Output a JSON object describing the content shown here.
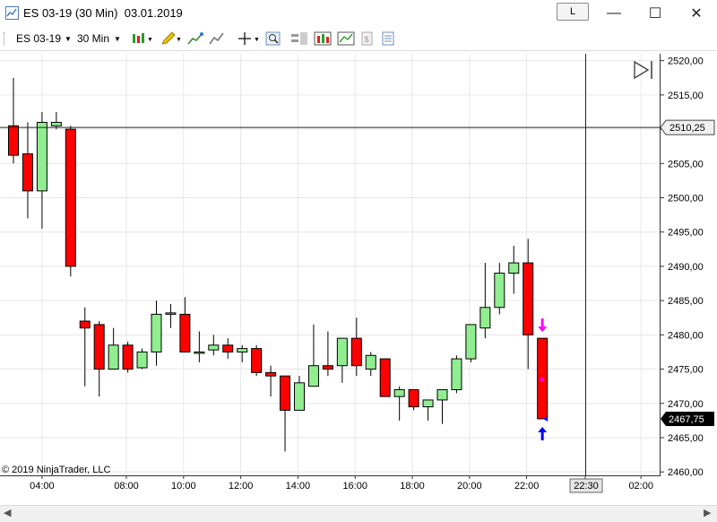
{
  "window": {
    "title": "ES 03-19 (30 Min)  03.01.2019",
    "link_button_label": "L",
    "minimize_glyph": "—",
    "maximize_glyph": "☐",
    "close_glyph": "✕"
  },
  "toolbar": {
    "instrument": "ES 03-19",
    "interval": "30 Min"
  },
  "chart": {
    "copyright": "© 2019 NinjaTrader, LLC",
    "crosshair_time_label": "22:30",
    "crosshair_price_label": "2510,25",
    "last_price_label": "2467,75"
  },
  "colors": {
    "up_candle": "#90ee90",
    "down_candle": "#ff0000",
    "sell_marker": "#ff00ff",
    "buy_marker": "#0000ff"
  },
  "chart_data": {
    "type": "candlestick",
    "title": "ES 03-19 (30 Min)",
    "y_ticks": [
      2460,
      2465,
      2470,
      2475,
      2480,
      2485,
      2490,
      2495,
      2500,
      2505,
      2510,
      2515,
      2520
    ],
    "y_tick_labels": [
      "2460,00",
      "2465,00",
      "2470,00",
      "2475,00",
      "2480,00",
      "2485,00",
      "2490,00",
      "2495,00",
      "2500,00",
      "2505,00",
      "2510,00",
      "2515,00",
      "2520,00"
    ],
    "x_tick_labels": [
      "04:00",
      "08:00",
      "10:00",
      "12:00",
      "14:00",
      "16:00",
      "18:00",
      "20:00",
      "22:00",
      "22:30",
      "02:00"
    ],
    "ylim": [
      2459.5,
      2521.0
    ],
    "grid": true,
    "candles": [
      {
        "o": 2510.5,
        "h": 2517.5,
        "l": 2505.0,
        "c": 2506.2
      },
      {
        "o": 2506.4,
        "h": 2511.0,
        "l": 2497.0,
        "c": 2501.0
      },
      {
        "o": 2501.0,
        "h": 2512.5,
        "l": 2495.5,
        "c": 2511.0
      },
      {
        "o": 2510.5,
        "h": 2512.5,
        "l": 2510.0,
        "c": 2511.0
      },
      {
        "o": 2510.0,
        "h": 2510.5,
        "l": 2488.5,
        "c": 2490.0
      },
      {
        "o": 2482.0,
        "h": 2484.0,
        "l": 2472.5,
        "c": 2481.0
      },
      {
        "o": 2481.5,
        "h": 2482.0,
        "l": 2471.0,
        "c": 2475.0
      },
      {
        "o": 2475.0,
        "h": 2481.0,
        "l": 2475.0,
        "c": 2478.5
      },
      {
        "o": 2478.5,
        "h": 2479.0,
        "l": 2474.5,
        "c": 2475.0
      },
      {
        "o": 2475.2,
        "h": 2478.0,
        "l": 2475.0,
        "c": 2477.5
      },
      {
        "o": 2477.5,
        "h": 2485.0,
        "l": 2475.5,
        "c": 2483.0
      },
      {
        "o": 2483.2,
        "h": 2484.5,
        "l": 2481.0,
        "c": 2483.2
      },
      {
        "o": 2483.0,
        "h": 2485.5,
        "l": 2477.5,
        "c": 2477.5
      },
      {
        "o": 2477.5,
        "h": 2480.5,
        "l": 2476.0,
        "c": 2477.5
      },
      {
        "o": 2477.8,
        "h": 2480.0,
        "l": 2477.0,
        "c": 2478.5
      },
      {
        "o": 2478.5,
        "h": 2479.5,
        "l": 2476.5,
        "c": 2477.5
      },
      {
        "o": 2477.5,
        "h": 2478.5,
        "l": 2476.0,
        "c": 2478.0
      },
      {
        "o": 2478.0,
        "h": 2478.5,
        "l": 2474.0,
        "c": 2474.5
      },
      {
        "o": 2474.5,
        "h": 2475.5,
        "l": 2471.0,
        "c": 2474.0
      },
      {
        "o": 2474.0,
        "h": 2474.0,
        "l": 2463.0,
        "c": 2469.0
      },
      {
        "o": 2469.0,
        "h": 2474.0,
        "l": 2469.0,
        "c": 2473.0
      },
      {
        "o": 2472.5,
        "h": 2481.5,
        "l": 2472.5,
        "c": 2475.5
      },
      {
        "o": 2475.5,
        "h": 2480.5,
        "l": 2474.0,
        "c": 2475.0
      },
      {
        "o": 2475.5,
        "h": 2479.5,
        "l": 2473.0,
        "c": 2479.5
      },
      {
        "o": 2479.5,
        "h": 2482.5,
        "l": 2474.0,
        "c": 2475.5
      },
      {
        "o": 2475.0,
        "h": 2477.5,
        "l": 2474.0,
        "c": 2477.0
      },
      {
        "o": 2476.5,
        "h": 2476.5,
        "l": 2471.0,
        "c": 2471.0
      },
      {
        "o": 2471.0,
        "h": 2472.5,
        "l": 2467.5,
        "c": 2472.0
      },
      {
        "o": 2472.0,
        "h": 2472.0,
        "l": 2469.0,
        "c": 2469.5
      },
      {
        "o": 2469.5,
        "h": 2470.5,
        "l": 2467.5,
        "c": 2470.5
      },
      {
        "o": 2470.5,
        "h": 2472.0,
        "l": 2467.0,
        "c": 2472.0
      },
      {
        "o": 2472.0,
        "h": 2477.0,
        "l": 2471.5,
        "c": 2476.5
      },
      {
        "o": 2476.5,
        "h": 2481.5,
        "l": 2476.0,
        "c": 2481.5
      },
      {
        "o": 2481.0,
        "h": 2490.5,
        "l": 2479.5,
        "c": 2484.0
      },
      {
        "o": 2484.0,
        "h": 2490.5,
        "l": 2483.0,
        "c": 2489.0
      },
      {
        "o": 2489.0,
        "h": 2493.0,
        "l": 2486.0,
        "c": 2490.5
      },
      {
        "o": 2490.5,
        "h": 2494.0,
        "l": 2475.0,
        "c": 2480.0
      },
      {
        "o": 2479.5,
        "h": 2479.5,
        "l": 2467.75,
        "c": 2467.75
      }
    ],
    "signals": [
      {
        "type": "sell",
        "candle": 37
      },
      {
        "type": "buy",
        "candle": 37
      }
    ]
  }
}
